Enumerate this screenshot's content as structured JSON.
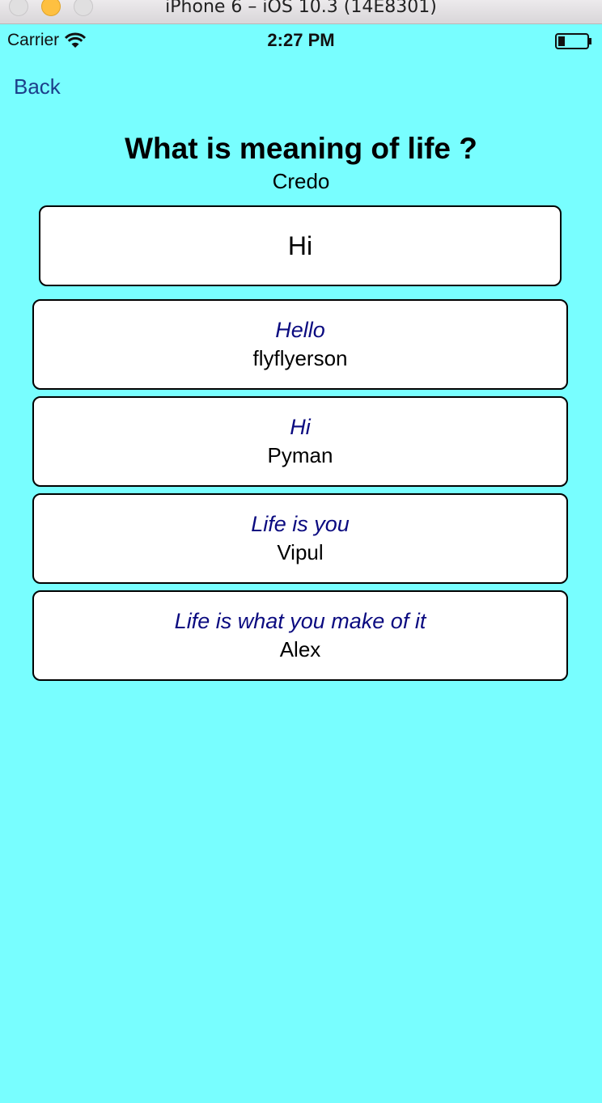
{
  "window": {
    "title": "iPhone 6 – iOS 10.3 (14E8301)"
  },
  "status_bar": {
    "carrier": "Carrier",
    "time": "2:27 PM",
    "icons": [
      "wifi-icon",
      "battery-icon"
    ]
  },
  "nav": {
    "back_label": "Back"
  },
  "question": {
    "title": "What is meaning of life ?",
    "author": "Credo"
  },
  "answer_input": {
    "value": "Hi"
  },
  "answers": [
    {
      "text": "Hello",
      "user": "flyflyerson"
    },
    {
      "text": "Hi",
      "user": "Pyman"
    },
    {
      "text": "Life is you",
      "user": "Vipul"
    },
    {
      "text": "Life is what you make of it",
      "user": "Alex"
    }
  ],
  "colors": {
    "background": "#78FEFF",
    "answer_text": "#0B0B80",
    "back_link": "#1C3F8A"
  }
}
